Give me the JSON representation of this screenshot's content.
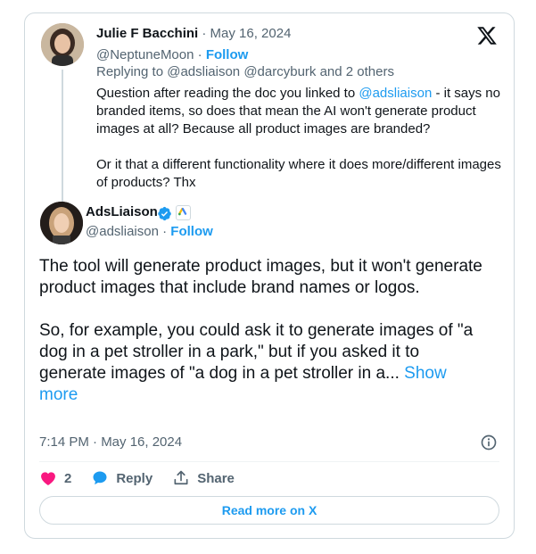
{
  "parent_tweet": {
    "name": "Julie F Bacchini",
    "date_meta": " · May 16, 2024",
    "handle": "@NeptuneMoon",
    "separator": " · ",
    "follow_label": "Follow",
    "replying_to": "Replying to @adsliaison @darcyburk and 2 others",
    "text_1a": "Question after reading the doc you linked to ",
    "text_1_mention": "@adsliaison",
    "text_1b": "  - it says no branded items, so does that mean the AI won't generate product images at all? Because all product images are branded?",
    "text_2": "Or it that a different functionality where it does more/different images of products? Thx"
  },
  "reply_tweet": {
    "name": "AdsLiaison",
    "handle": "@adsliaison",
    "separator": " · ",
    "follow_label": "Follow",
    "text_1": "The tool will generate product images, but it won't generate product images that include brand names or logos.",
    "text_2": "So, for example, you could ask it to generate images of \"a dog in a pet stroller in a park,\" but if you asked it to generate images of \"a dog in a pet stroller in a... ",
    "show_more": "Show more",
    "timestamp": "7:14 PM · May 16, 2024"
  },
  "actions": {
    "like_count": "2",
    "reply_label": "Reply",
    "share_label": "Share"
  },
  "read_more_label": "Read more on X",
  "colors": {
    "accent": "#1d9bf0",
    "like": "#f91880",
    "muted": "#536471",
    "border": "#cfd9de"
  }
}
